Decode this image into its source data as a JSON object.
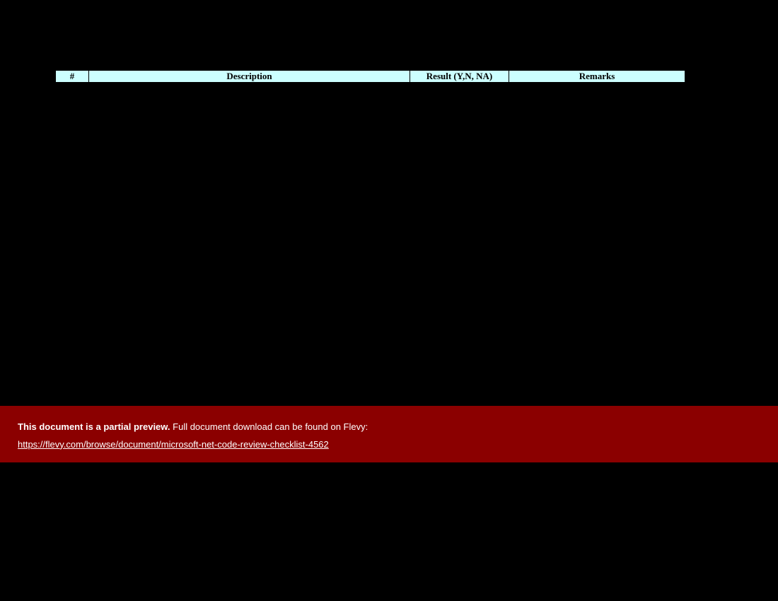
{
  "table": {
    "headers": {
      "num": "#",
      "description": "Description",
      "result": "Result (Y,N, NA)",
      "remarks": "Remarks"
    }
  },
  "banner": {
    "bold_text": "This document is a partial preview.",
    "normal_text": "  Full document download can be found on Flevy:",
    "link_text": "https://flevy.com/browse/document/microsoft-net-code-review-checklist-4562"
  }
}
